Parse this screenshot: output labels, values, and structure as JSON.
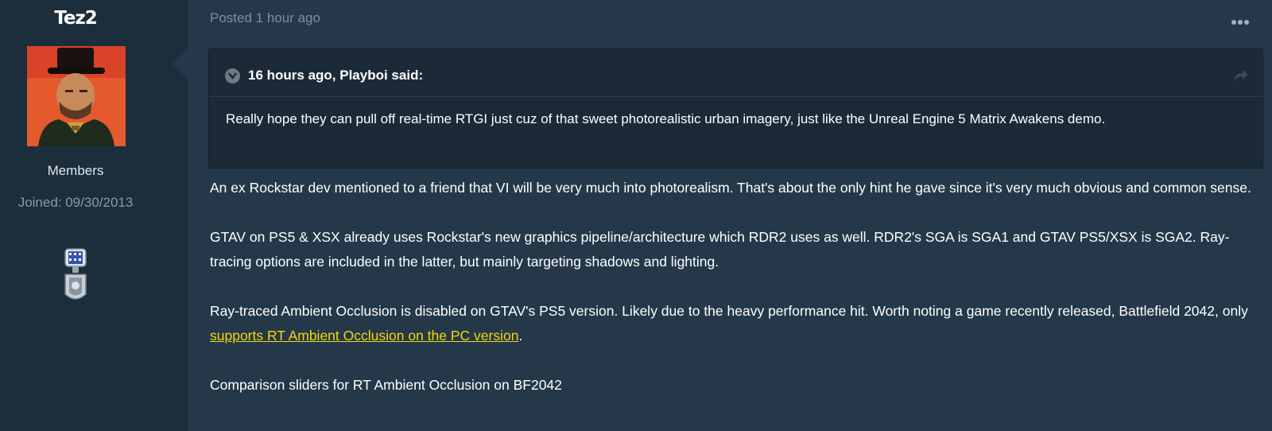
{
  "author": {
    "name": "Tez2",
    "group": "Members",
    "joined": "Joined: 09/30/2013"
  },
  "post": {
    "posted": "Posted 1 hour ago",
    "menu_icon": "ellipsis-icon",
    "quote": {
      "cite": "16 hours ago, Playboi said:",
      "text": "Really hope they can pull off real-time RTGI just cuz of that sweet photorealistic urban imagery, just like the Unreal Engine 5 Matrix Awakens demo."
    },
    "paragraphs": [
      "An ex Rockstar dev mentioned to a friend that VI will be very much into photorealism. That's about the only hint he gave since it's very much obvious and common sense.",
      "GTAV on PS5 & XSX already uses Rockstar's new graphics pipeline/architecture which RDR2 uses as well. RDR2's SGA is SGA1 and GTAV PS5/XSX is SGA2. Ray-tracing options are included in the latter, but mainly targeting shadows and lighting."
    ],
    "paragraph3_before_link": "Ray-traced Ambient Occlusion is disabled on GTAV's PS5 version. Likely due to the heavy performance hit. Worth noting a game recently released, Battlefield 2042, only ",
    "link_text": "supports RT Ambient Occlusion on the PC version",
    "paragraph3_after_link": ".",
    "paragraph4": "Comparison sliders for RT Ambient Occlusion on BF2042"
  },
  "colors": {
    "page_bg": "#243849",
    "author_panel_bg": "#1c2d3b",
    "quote_bg": "#1c2a38",
    "link": "#f1d70d",
    "muted_text": "#7e8c99"
  }
}
